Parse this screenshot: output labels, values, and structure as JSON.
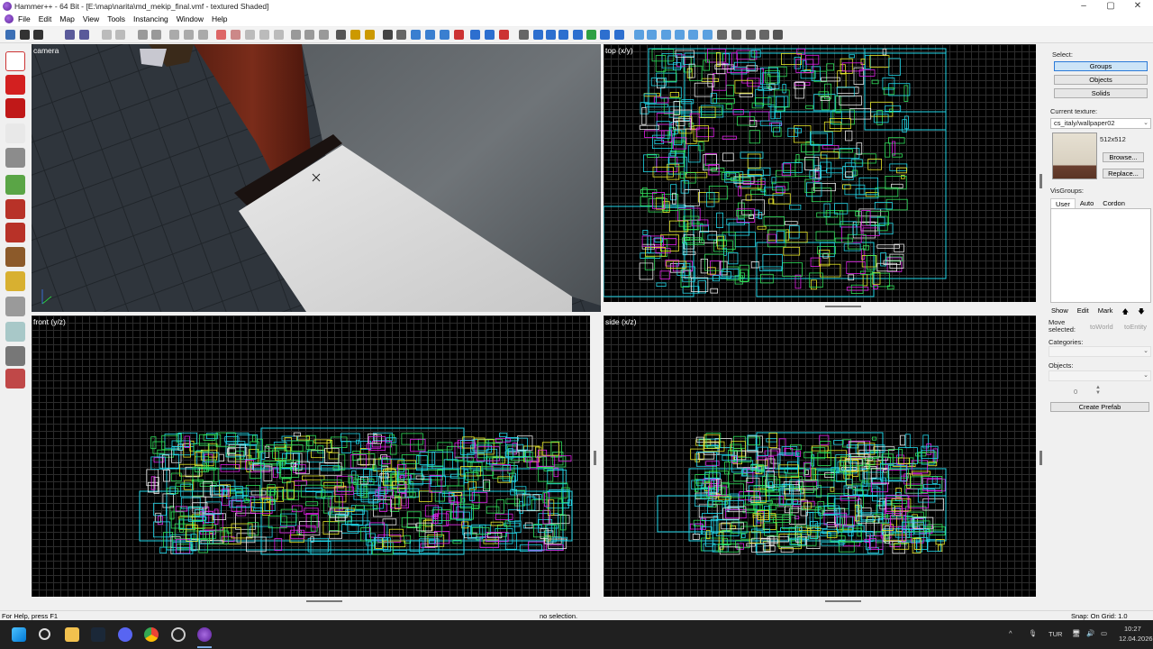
{
  "window": {
    "title": "Hammer++ - 64 Bit - [E:\\map\\narita\\md_mekip_final.vmf - textured Shaded]",
    "controls": [
      "–",
      "▢",
      "✕"
    ]
  },
  "menu": [
    "File",
    "Edit",
    "Map",
    "View",
    "Tools",
    "Instancing",
    "Window",
    "Help"
  ],
  "viewports": {
    "camera": "camera",
    "top": "top (x/y)",
    "front": "front (y/z)",
    "side": "side (x/z)"
  },
  "panel": {
    "select_label": "Select:",
    "select_buttons": [
      "Groups",
      "Objects",
      "Solids"
    ],
    "current_texture_label": "Current texture:",
    "texture_name": "cs_italy/wallpaper02",
    "texture_size": "512x512",
    "browse": "Browse...",
    "replace": "Replace...",
    "visgroups_label": "VisGroups:",
    "visgroup_tabs": [
      "User",
      "Auto",
      "Cordon"
    ],
    "vis_actions": [
      "Show",
      "Edit",
      "Mark"
    ],
    "move_selected": "Move selected:",
    "to_world": "toWorld",
    "to_entity": "toEntity",
    "categories_label": "Categories:",
    "objects_label": "Objects:",
    "objects_count": "0",
    "create_prefab": "Create Prefab"
  },
  "status": {
    "help": "For Help, press F1",
    "selection": "no selection.",
    "snap": "Snap: On Grid: 1.0"
  },
  "taskbar": {
    "lang": "TUR",
    "time": "10:27",
    "date": "12.04.2026"
  },
  "colors": {
    "grid_major": "#1c6b74",
    "brush_green": "#2fe05a",
    "brush_magenta": "#e020e8",
    "brush_yellow": "#e8e82a",
    "brush_cyan": "#21d6e8",
    "brush_white": "#e8e8e8"
  }
}
